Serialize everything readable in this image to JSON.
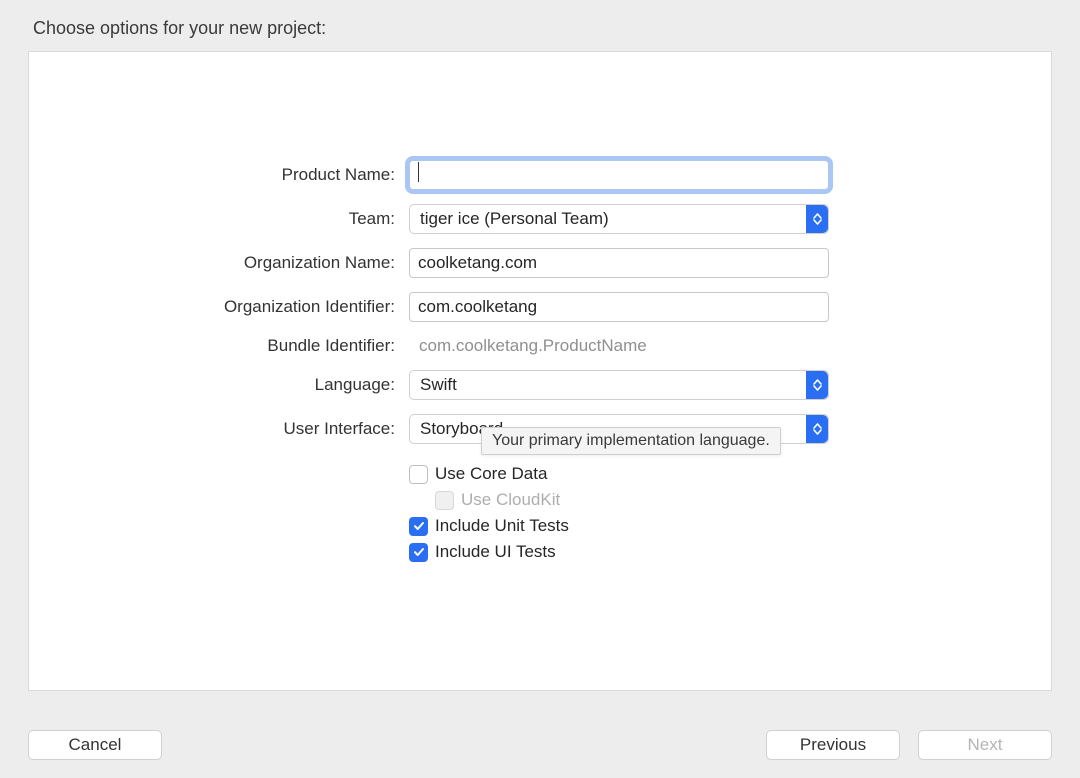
{
  "heading": "Choose options for your new project:",
  "form": {
    "product_name": {
      "label": "Product Name:",
      "value": ""
    },
    "team": {
      "label": "Team:",
      "value": "tiger ice (Personal Team)"
    },
    "org_name": {
      "label": "Organization Name:",
      "value": "coolketang.com"
    },
    "org_identifier": {
      "label": "Organization Identifier:",
      "value": "com.coolketang"
    },
    "bundle_identifier": {
      "label": "Bundle Identifier:",
      "value": "com.coolketang.ProductName"
    },
    "language": {
      "label": "Language:",
      "value": "Swift"
    },
    "user_interface": {
      "label": "User Interface:",
      "value": "Storyboard"
    },
    "use_core_data": {
      "label": "Use Core Data",
      "checked": false,
      "enabled": true
    },
    "use_cloudkit": {
      "label": "Use CloudKit",
      "checked": false,
      "enabled": false
    },
    "include_unit_tests": {
      "label": "Include Unit Tests",
      "checked": true,
      "enabled": true
    },
    "include_ui_tests": {
      "label": "Include UI Tests",
      "checked": true,
      "enabled": true
    }
  },
  "tooltip": "Your primary implementation language.",
  "buttons": {
    "cancel": "Cancel",
    "previous": "Previous",
    "next": "Next"
  }
}
